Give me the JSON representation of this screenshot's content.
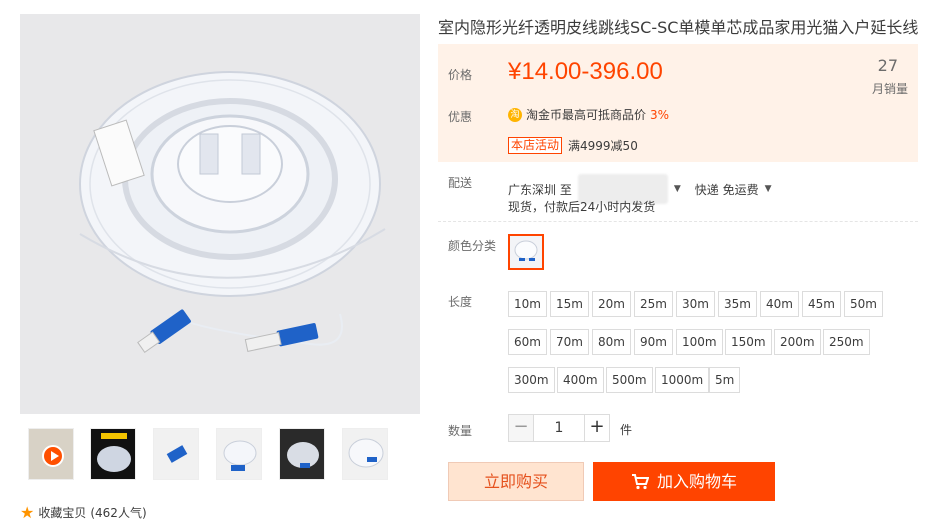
{
  "product": {
    "title": "室内隐形光纤透明皮线跳线SC-SC单模单芯成品家用光猫入户延长线"
  },
  "price_box": {
    "price_label": "价格",
    "price": "¥14.00-396.00",
    "sales_count": "27",
    "sales_label": "月销量",
    "promo_label": "优惠",
    "taojin_icon": "淘",
    "taojin_text": "淘金币最高可抵商品价",
    "taojin_pct": "3%",
    "shop_tag": "本店活动",
    "shop_deal": "满4999减50"
  },
  "shipping": {
    "label": "配送",
    "from": "广东深圳 至",
    "method": "快递 免运费",
    "note": "现货，付款后24小时内发货"
  },
  "color": {
    "label": "颜色分类"
  },
  "length": {
    "label": "长度",
    "options": [
      "10m",
      "15m",
      "20m",
      "25m",
      "30m",
      "35m",
      "40m",
      "45m",
      "50m",
      "60m",
      "70m",
      "80m",
      "90m",
      "100m",
      "150m",
      "200m",
      "250m",
      "300m",
      "400m",
      "500m",
      "1000m",
      "5m"
    ]
  },
  "quantity": {
    "label": "数量",
    "value": "1",
    "minus": "−",
    "plus": "+",
    "unit": "件"
  },
  "actions": {
    "buy_now": "立即购买",
    "add_cart": "加入购物车"
  },
  "favorite": {
    "text": "收藏宝贝",
    "popularity": "(462人气)"
  }
}
